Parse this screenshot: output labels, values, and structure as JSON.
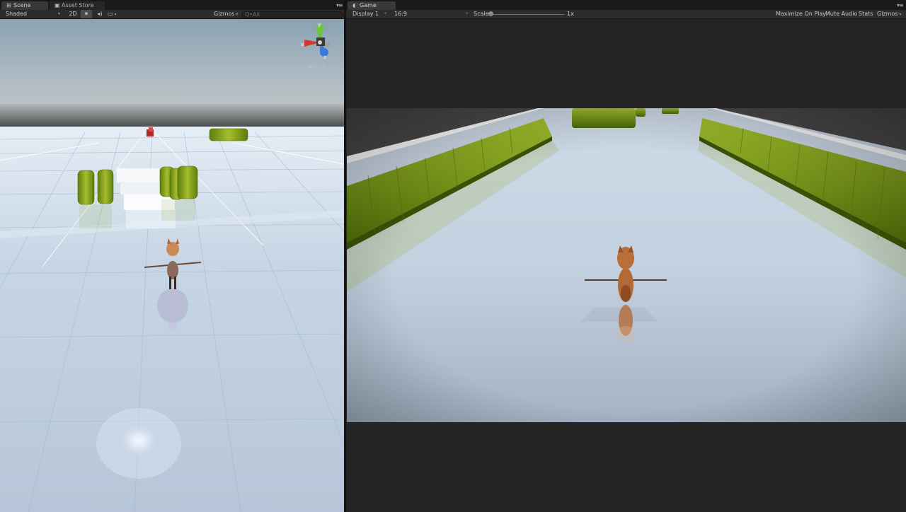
{
  "scene_panel": {
    "tabs": [
      {
        "label": "Scene",
        "icon": "grid-icon",
        "active": true
      },
      {
        "label": "Asset Store",
        "icon": "store-icon",
        "active": false
      }
    ],
    "toolbar": {
      "shading_mode": "Shaded",
      "mode_2d": "2D",
      "lighting_icon": "sun-icon",
      "audio_icon": "speaker-icon",
      "effects_icon": "image-icon",
      "gizmos_label": "Gizmos",
      "search_placeholder": "Q•All"
    },
    "view_gizmo": {
      "y_label": "y",
      "z_label": "z",
      "x_label": "x",
      "projection_label": "Persp"
    }
  },
  "game_panel": {
    "tab": {
      "label": "Game",
      "icon": "pacman-icon"
    },
    "toolbar": {
      "display": "Display 1",
      "aspect": "16:9",
      "scale_label": "Scale",
      "scale_value": "1x",
      "scale_fraction": 0.0,
      "maximize_on_play": "Maximize On Play",
      "mute_audio": "Mute Audio",
      "stats": "Stats",
      "gizmos": "Gizmos"
    }
  },
  "colors": {
    "editor_bg": "#1e1e1e",
    "tab_active": "#393939",
    "toolbar_bg": "#2c2c2c",
    "floor": "#c4d2e0",
    "hedge": "#7a9a18",
    "character": "#b76c38",
    "axis_x": "#d23a2a",
    "axis_y": "#6cc43a",
    "axis_z": "#3a7ad8"
  }
}
